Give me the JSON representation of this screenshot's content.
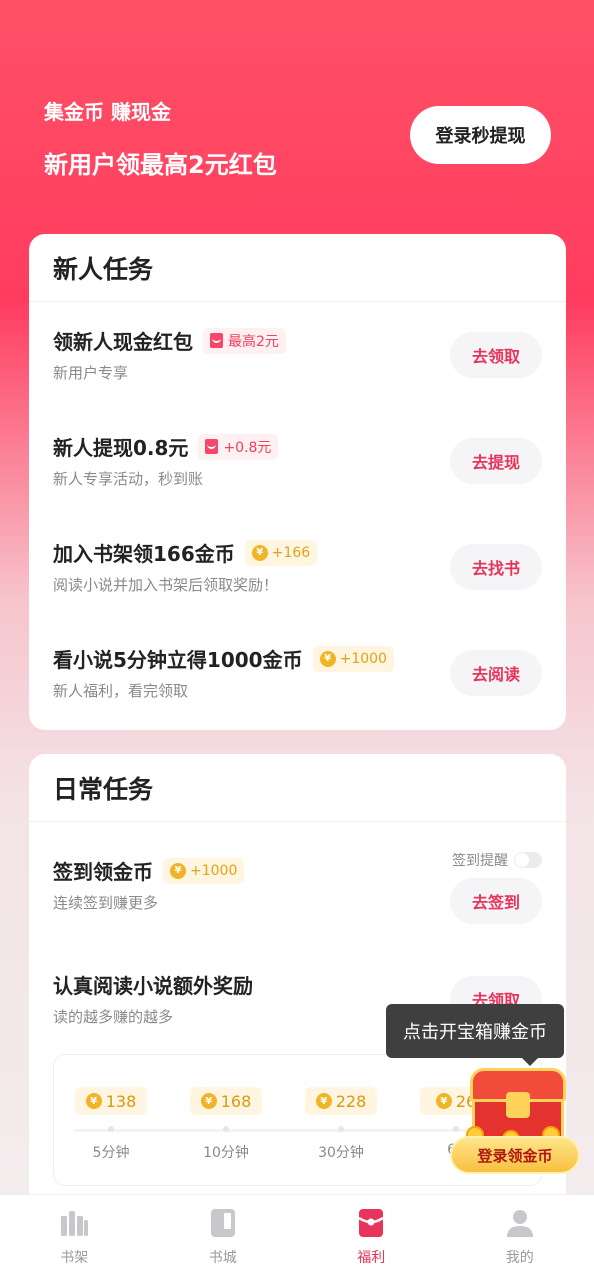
{
  "hero": {
    "line1": "集金币 赚现金",
    "line2": "新用户领最高2元红包",
    "login_button": "登录秒提现"
  },
  "new_tasks": {
    "title": "新人任务",
    "items": [
      {
        "name": "领新人现金红包",
        "badge": "最高2元",
        "badge_type": "envelope",
        "sub": "新用户专享",
        "button": "去领取"
      },
      {
        "name": "新人提现0.8元",
        "badge": "+0.8元",
        "badge_type": "envelope",
        "sub": "新人专享活动，秒到账",
        "button": "去提现"
      },
      {
        "name": "加入书架领166金币",
        "badge": "+166",
        "badge_type": "coin",
        "sub": "阅读小说并加入书架后领取奖励！",
        "button": "去找书"
      },
      {
        "name": "看小说5分钟立得1000金币",
        "badge": "+1000",
        "badge_type": "coin",
        "sub": "新人福利，看完领取",
        "button": "去阅读"
      }
    ]
  },
  "daily_tasks": {
    "title": "日常任务",
    "checkin": {
      "name": "签到领金币",
      "badge": "+1000",
      "sub": "连续签到赚更多",
      "button": "去签到",
      "remind_label": "签到提醒"
    },
    "reading": {
      "name": "认真阅读小说额外奖励",
      "sub": "读的越多赚的越多",
      "button": "去领取"
    },
    "milestones": [
      {
        "coins": "138",
        "label": "5分钟"
      },
      {
        "coins": "168",
        "label": "10分钟"
      },
      {
        "coins": "228",
        "label": "30分钟"
      },
      {
        "coins": "26",
        "label": "60"
      }
    ]
  },
  "treasure": {
    "tooltip": "点击开宝箱赚金币",
    "button": "登录领金币"
  },
  "coin_symbol": "¥",
  "tabbar": {
    "items": [
      {
        "label": "书架",
        "icon": "bookshelf-icon",
        "active": false
      },
      {
        "label": "书城",
        "icon": "book-icon",
        "active": false
      },
      {
        "label": "福利",
        "icon": "red-envelope-icon",
        "active": true
      },
      {
        "label": "我的",
        "icon": "user-icon",
        "active": false
      }
    ]
  },
  "colors": {
    "accent": "#e8345a",
    "gold": "#f2b425",
    "background_top": "#ff5166"
  }
}
